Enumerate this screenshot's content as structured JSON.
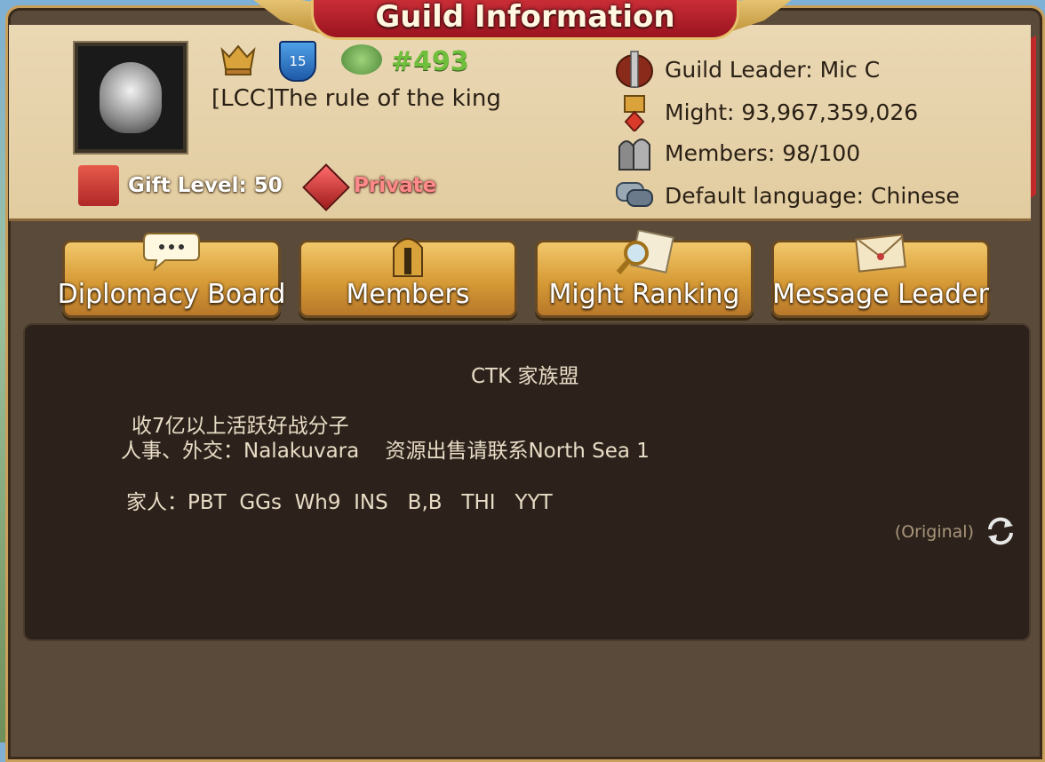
{
  "title": "Guild Information",
  "guild": {
    "rank": "#493",
    "level": "15",
    "name": "[LCC]The rule of the king",
    "gift_level": "Gift Level: 50",
    "privacy": "Private"
  },
  "info": {
    "leader": "Guild Leader: Mic C",
    "might": "Might: 93,967,359,026",
    "members": "Members: 98/100",
    "language": "Default language: Chinese"
  },
  "buttons": {
    "diplomacy": "Diplomacy Board",
    "members": "Members",
    "might_ranking": "Might Ranking",
    "message_leader": "Message Leader"
  },
  "board": {
    "heading": "CTK 家族盟",
    "line1": "收7亿以上活跃好战分子",
    "line2": "人事、外交：Nalakuvara    资源出售请联系North Sea 1",
    "line3": "家人：PBT  GGs  Wh9  INS   B,B   THI   YYT",
    "original_label": "(Original)"
  },
  "colors": {
    "banner": "#c42a32",
    "panel": "#e6d2aa",
    "button": "#d69a36",
    "board_bg": "#2c221b",
    "rank_green": "#6fbf3c"
  },
  "icons": [
    "guild-emblem-icon",
    "rank-crown-icon",
    "level-shield-icon",
    "tree-icon",
    "gift-icon",
    "private-gem-icon",
    "leader-icon",
    "might-icon",
    "members-icon",
    "language-chat-icon",
    "chat-bubble-icon",
    "helmet-icon",
    "magnifier-icon",
    "envelope-icon",
    "refresh-icon"
  ]
}
